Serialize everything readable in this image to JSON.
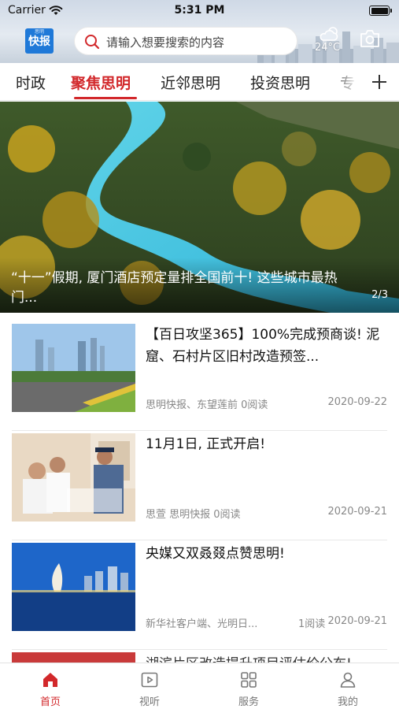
{
  "status_bar": {
    "carrier": "Carrier",
    "time": "5:31 PM"
  },
  "header": {
    "logo_small": "思明",
    "logo_text": "快报",
    "search_placeholder": "请输入想要搜索的内容",
    "weather_temp": "24°C",
    "weather_icon": "cloudy-sun-icon",
    "camera_icon": "camera-icon"
  },
  "tabs": {
    "items": [
      "时政",
      "聚焦思明",
      "近邻思明",
      "投资思明",
      "专"
    ],
    "active_index": 1,
    "add_icon": "plus-icon"
  },
  "banner": {
    "caption": "“十一”假期, 厦门酒店预定量排全国前十! 这些城市最热门...",
    "counter": "2/3"
  },
  "news": [
    {
      "title": "【百日攻坚365】100%完成预商谈! 泥窟、石村片区旧村改造预签...",
      "meta": "思明快报、东望莲前 0阅读",
      "date": "2020-09-22"
    },
    {
      "title": "11月1日, 正式开启!",
      "meta": "思萱 思明快报 0阅读",
      "date": "2020-09-21"
    },
    {
      "title": "央媒又双叒叕点赞思明!",
      "meta": "新华社客户端、光明日...",
      "reads": "1阅读",
      "date": "2020-09-21"
    }
  ],
  "partial_news_title": "湖滨片区改造提升项目评估价公布!",
  "bottom_nav": [
    {
      "label": "首页",
      "icon": "home-icon",
      "active": true
    },
    {
      "label": "视听",
      "icon": "video-play-icon",
      "active": false
    },
    {
      "label": "服务",
      "icon": "grid-services-icon",
      "active": false
    },
    {
      "label": "我的",
      "icon": "user-icon",
      "active": false
    }
  ],
  "colors": {
    "accent": "#d2282b",
    "logo_blue": "#1f79d8"
  }
}
